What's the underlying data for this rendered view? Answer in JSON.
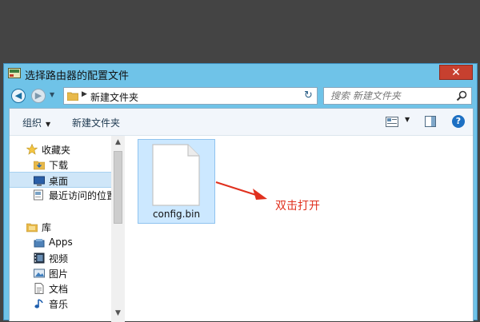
{
  "window": {
    "title": "选择路由器的配置文件",
    "close_label": "✕"
  },
  "address_bar": {
    "current_folder": "新建文件夹",
    "search_placeholder": "搜索 新建文件夹"
  },
  "toolbar": {
    "organize_label": "组织",
    "new_folder_label": "新建文件夹",
    "help_label": "?"
  },
  "nav_pane": {
    "items": [
      {
        "label": "收藏夹",
        "icon": "star-icon"
      },
      {
        "label": "下载",
        "icon": "download-folder-icon"
      },
      {
        "label": "桌面",
        "icon": "desktop-icon",
        "selected": true
      },
      {
        "label": "最近访问的位置",
        "icon": "recent-places-icon"
      },
      {
        "label": "库",
        "icon": "library-icon"
      },
      {
        "label": "Apps",
        "icon": "apps-icon"
      },
      {
        "label": "视频",
        "icon": "video-icon"
      },
      {
        "label": "图片",
        "icon": "pictures-icon"
      },
      {
        "label": "文档",
        "icon": "documents-icon"
      },
      {
        "label": "音乐",
        "icon": "music-icon"
      }
    ]
  },
  "files": [
    {
      "name": "config.bin",
      "icon": "file-icon",
      "selected": true
    }
  ],
  "annotation": {
    "text": "双击打开",
    "color": "#e0301e"
  }
}
